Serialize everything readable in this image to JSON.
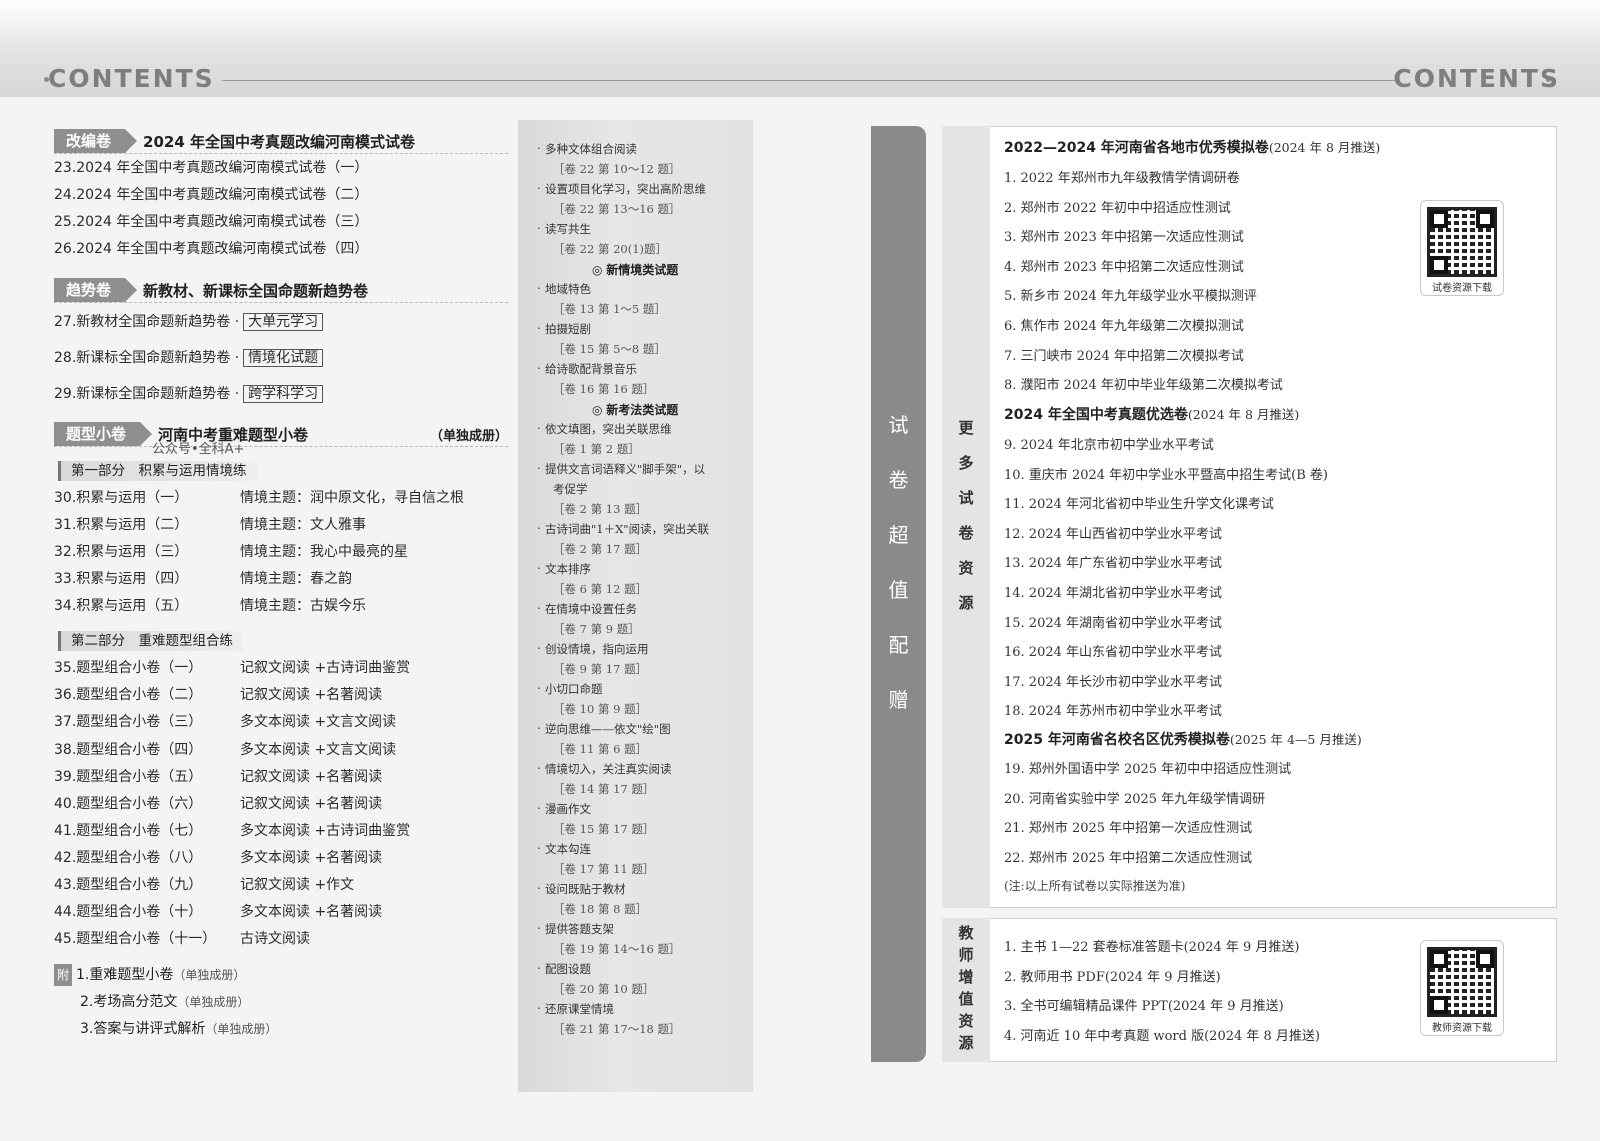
{
  "header": {
    "left_title": "CONTENTS",
    "right_title": "CONTENTS"
  },
  "section1": {
    "tag": "改编卷",
    "title": "2024 年全国中考真题改编河南模式试卷",
    "rows": [
      "23.2024 年全国中考真题改编河南模式试卷（一）",
      "24.2024 年全国中考真题改编河南模式试卷（二）",
      "25.2024 年全国中考真题改编河南模式试卷（三）",
      "26.2024 年全国中考真题改编河南模式试卷（四）"
    ]
  },
  "section2": {
    "tag": "趋势卷",
    "title": "新教材、新课标全国命题新趋势卷",
    "rows": [
      {
        "label": "27.新教材全国命题新趋势卷 ·",
        "box": "大单元学习"
      },
      {
        "label": "28.新课标全国命题新趋势卷 ·",
        "box": "情境化试题"
      },
      {
        "label": "29.新课标全国命题新趋势卷 ·",
        "box": "跨学科学习"
      }
    ]
  },
  "section3": {
    "tag": "题型小卷",
    "title": "河南中考重难题型小卷",
    "note": "（单独成册）",
    "watermark": "公众号•全科A+",
    "part1": {
      "title": "第一部分　积累与运用情境练",
      "rows": [
        {
          "no": "30.积累与运用（一）",
          "desc": "情境主题：润中原文化，寻自信之根"
        },
        {
          "no": "31.积累与运用（二）",
          "desc": "情境主题：文人雅事"
        },
        {
          "no": "32.积累与运用（三）",
          "desc": "情境主题：我心中最亮的星"
        },
        {
          "no": "33.积累与运用（四）",
          "desc": "情境主题：春之韵"
        },
        {
          "no": "34.积累与运用（五）",
          "desc": "情境主题：古娱今乐"
        }
      ]
    },
    "part2": {
      "title": "第二部分　重难题型组合练",
      "rows": [
        {
          "no": "35.题型组合小卷（一）",
          "desc": "记叙文阅读 +古诗词曲鉴赏"
        },
        {
          "no": "36.题型组合小卷（二）",
          "desc": "记叙文阅读 +名著阅读"
        },
        {
          "no": "37.题型组合小卷（三）",
          "desc": "多文本阅读 +文言文阅读"
        },
        {
          "no": "38.题型组合小卷（四）",
          "desc": "多文本阅读 +文言文阅读"
        },
        {
          "no": "39.题型组合小卷（五）",
          "desc": "记叙文阅读 +名著阅读"
        },
        {
          "no": "40.题型组合小卷（六）",
          "desc": "记叙文阅读 +名著阅读"
        },
        {
          "no": "41.题型组合小卷（七）",
          "desc": "多文本阅读 +古诗词曲鉴赏"
        },
        {
          "no": "42.题型组合小卷（八）",
          "desc": "多文本阅读 +名著阅读"
        },
        {
          "no": "43.题型组合小卷（九）",
          "desc": "记叙文阅读 +作文"
        },
        {
          "no": "44.题型组合小卷（十）",
          "desc": "多文本阅读 +名著阅读"
        },
        {
          "no": "45.题型组合小卷（十一）",
          "desc": "古诗文阅读"
        }
      ]
    }
  },
  "appendix": {
    "tag": "附",
    "items": [
      {
        "text": "1.重难题型小卷",
        "note": "（单独成册）"
      },
      {
        "text": "2.考场高分范文",
        "note": "（单独成册）"
      },
      {
        "text": "3.答案与讲评式解析",
        "note": "（单独成册）"
      }
    ]
  },
  "middle": {
    "items": [
      {
        "kind": "item",
        "text": "多种文体组合阅读"
      },
      {
        "kind": "ref",
        "text": "［卷 22 第 10～12 题］"
      },
      {
        "kind": "item",
        "text": "设置项目化学习，突出高阶思维"
      },
      {
        "kind": "ref",
        "text": "［卷 22 第 13～16 题］"
      },
      {
        "kind": "item",
        "text": "读写共生"
      },
      {
        "kind": "ref",
        "text": "［卷 22 第 20(1)题］"
      },
      {
        "kind": "sub",
        "text": "新情境类试题"
      },
      {
        "kind": "item",
        "text": "地域特色"
      },
      {
        "kind": "ref",
        "text": "［卷 13 第 1～5 题］"
      },
      {
        "kind": "item",
        "text": "拍摄短剧"
      },
      {
        "kind": "ref",
        "text": "［卷 15 第 5～8 题］"
      },
      {
        "kind": "item",
        "text": "给诗歌配背景音乐"
      },
      {
        "kind": "ref",
        "text": "［卷 16 第 16 题］"
      },
      {
        "kind": "sub",
        "text": "新考法类试题"
      },
      {
        "kind": "item",
        "text": "依文填图，突出关联思维"
      },
      {
        "kind": "ref",
        "text": "［卷 1 第 2 题］"
      },
      {
        "kind": "item",
        "text": "提供文言词语释义\"脚手架\"，以"
      },
      {
        "kind": "item2",
        "text": "考促学"
      },
      {
        "kind": "ref",
        "text": "［卷 2 第 13 题］"
      },
      {
        "kind": "item",
        "text": "古诗词曲\"1＋X\"阅读，突出关联"
      },
      {
        "kind": "ref",
        "text": "［卷 2 第 17 题］"
      },
      {
        "kind": "item",
        "text": "文本排序"
      },
      {
        "kind": "ref",
        "text": "［卷 6 第 12 题］"
      },
      {
        "kind": "item",
        "text": "在情境中设置任务"
      },
      {
        "kind": "ref",
        "text": "［卷 7 第 9 题］"
      },
      {
        "kind": "item",
        "text": "创设情境，指向运用"
      },
      {
        "kind": "ref",
        "text": "［卷 9 第 17 题］"
      },
      {
        "kind": "item",
        "text": "小切口命题"
      },
      {
        "kind": "ref",
        "text": "［卷 10 第 9 题］"
      },
      {
        "kind": "item",
        "text": "逆向思维——依文\"绘\"图"
      },
      {
        "kind": "ref",
        "text": "［卷 11 第 6 题］"
      },
      {
        "kind": "item",
        "text": "情境切入，关注真实阅读"
      },
      {
        "kind": "ref",
        "text": "［卷 14 第 17 题］"
      },
      {
        "kind": "item",
        "text": "漫画作文"
      },
      {
        "kind": "ref",
        "text": "［卷 15 第 17 题］"
      },
      {
        "kind": "item",
        "text": "文本勾连"
      },
      {
        "kind": "ref",
        "text": "［卷 17 第 11 题］"
      },
      {
        "kind": "item",
        "text": "设问既贴于教材"
      },
      {
        "kind": "ref",
        "text": "［卷 18 第 8 题］"
      },
      {
        "kind": "item",
        "text": "提供答题支架"
      },
      {
        "kind": "ref",
        "text": "［卷 19 第 14～16 题］"
      },
      {
        "kind": "item",
        "text": "配图设题"
      },
      {
        "kind": "ref",
        "text": "［卷 20 第 10 题］"
      },
      {
        "kind": "item",
        "text": "还原课堂情境"
      },
      {
        "kind": "ref",
        "text": "［卷 21 第 17～18 题］"
      }
    ]
  },
  "right": {
    "vertical_label": [
      "试",
      "卷",
      "超",
      "值",
      "配",
      "赠"
    ],
    "panel1_side": [
      "更",
      "多",
      "试",
      "卷",
      "资",
      "源"
    ],
    "panel2_side": [
      "教",
      "师",
      "增",
      "值",
      "资",
      "源"
    ],
    "group1": {
      "title": "2022—2024 年河南省各地市优秀模拟卷",
      "push": "(2024 年 8 月推送)",
      "items": [
        "1. 2022 年郑州市九年级教情学情调研卷",
        "2. 郑州市 2022 年初中中招适应性测试",
        "3. 郑州市 2023 年中招第一次适应性测试",
        "4. 郑州市 2023 年中招第二次适应性测试",
        "5. 新乡市 2024 年九年级学业水平模拟测评",
        "6. 焦作市 2024 年九年级第二次模拟测试",
        "7. 三门峡市 2024 年中招第二次模拟考试",
        "8. 濮阳市 2024 年初中毕业年级第二次模拟考试"
      ]
    },
    "group2": {
      "title": "2024 年全国中考真题优选卷",
      "push": "(2024 年 8 月推送)",
      "items": [
        "9. 2024 年北京市初中学业水平考试",
        "10. 重庆市 2024 年初中学业水平暨高中招生考试(B 卷)",
        "11. 2024 年河北省初中毕业生升学文化课考试",
        "12. 2024 年山西省初中学业水平考试",
        "13. 2024 年广东省初中学业水平考试",
        "14. 2024 年湖北省初中学业水平考试",
        "15. 2024 年湖南省初中学业水平考试",
        "16. 2024 年山东省初中学业水平考试",
        "17. 2024 年长沙市初中学业水平考试",
        "18. 2024 年苏州市初中学业水平考试"
      ]
    },
    "group3": {
      "title": "2025 年河南省名校名区优秀模拟卷",
      "push": "(2025 年 4—5 月推送)",
      "items": [
        "19. 郑州外国语中学 2025 年初中中招适应性测试",
        "20. 河南省实验中学 2025 年九年级学情调研",
        "21. 郑州市 2025 年中招第一次适应性测试",
        "22. 郑州市 2025 年中招第二次适应性测试"
      ]
    },
    "note": "(注:以上所有试卷以实际推送为准)",
    "qr1_caption": "试卷资源下载",
    "teacher_items": [
      "1. 主书 1—22 套卷标准答题卡(2024 年 9 月推送)",
      "2. 教师用书 PDF(2024 年 9 月推送)",
      "3. 全书可编辑精品课件 PPT(2024 年 9 月推送)",
      "4. 河南近 10 年中考真题 word 版(2024 年 8 月推送)"
    ],
    "qr2_caption": "教师资源下载"
  }
}
